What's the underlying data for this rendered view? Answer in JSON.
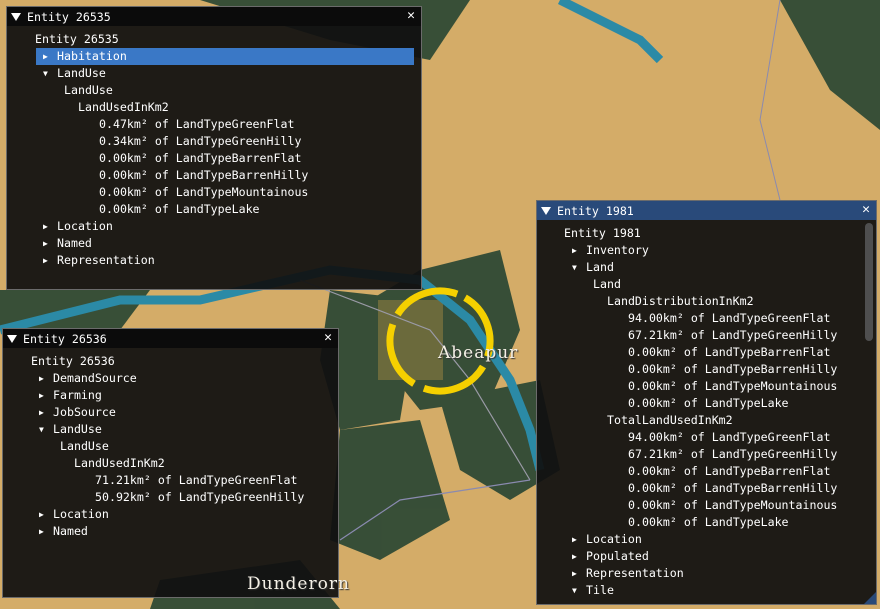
{
  "map": {
    "labels": [
      "Abeapur",
      "Dunderorn"
    ],
    "colors": {
      "sand": "#d4ac68",
      "forest": "#2f4a35",
      "river": "#2b8aa6",
      "marker": "#f5d000"
    }
  },
  "windows": [
    {
      "title": "Entity 26535",
      "root": "Entity 26535",
      "rows": [
        {
          "d": 1,
          "a": "closed",
          "t": "Habitation",
          "sel": true
        },
        {
          "d": 1,
          "a": "open",
          "t": "LandUse"
        },
        {
          "d": 2,
          "t": "LandUse"
        },
        {
          "d": 3,
          "t": "LandUsedInKm2"
        },
        {
          "d": 4,
          "t": "0.47km² of LandTypeGreenFlat"
        },
        {
          "d": 4,
          "t": "0.34km² of LandTypeGreenHilly"
        },
        {
          "d": 4,
          "t": "0.00km² of LandTypeBarrenFlat"
        },
        {
          "d": 4,
          "t": "0.00km² of LandTypeBarrenHilly"
        },
        {
          "d": 4,
          "t": "0.00km² of LandTypeMountainous"
        },
        {
          "d": 4,
          "t": "0.00km² of LandTypeLake"
        },
        {
          "d": 1,
          "a": "closed",
          "t": "Location"
        },
        {
          "d": 1,
          "a": "closed",
          "t": "Named"
        },
        {
          "d": 1,
          "a": "closed",
          "t": "Representation"
        }
      ]
    },
    {
      "title": "Entity 26536",
      "root": "Entity 26536",
      "rows": [
        {
          "d": 1,
          "a": "closed",
          "t": "DemandSource"
        },
        {
          "d": 1,
          "a": "closed",
          "t": "Farming"
        },
        {
          "d": 1,
          "a": "closed",
          "t": "JobSource"
        },
        {
          "d": 1,
          "a": "open",
          "t": "LandUse"
        },
        {
          "d": 2,
          "t": "LandUse"
        },
        {
          "d": 3,
          "t": "LandUsedInKm2"
        },
        {
          "d": 4,
          "t": "71.21km² of LandTypeGreenFlat"
        },
        {
          "d": 4,
          "t": "50.92km² of LandTypeGreenHilly"
        },
        {
          "d": 1,
          "a": "closed",
          "t": "Location"
        },
        {
          "d": 1,
          "a": "closed",
          "t": "Named"
        }
      ]
    },
    {
      "title": "Entity 1981",
      "root": "Entity 1981",
      "rows": [
        {
          "d": 1,
          "a": "closed",
          "t": "Inventory"
        },
        {
          "d": 1,
          "a": "open",
          "t": "Land"
        },
        {
          "d": 2,
          "t": "Land"
        },
        {
          "d": 3,
          "t": "LandDistributionInKm2"
        },
        {
          "d": 4,
          "t": "94.00km² of LandTypeGreenFlat"
        },
        {
          "d": 4,
          "t": "67.21km² of LandTypeGreenHilly"
        },
        {
          "d": 4,
          "t": "0.00km² of LandTypeBarrenFlat"
        },
        {
          "d": 4,
          "t": "0.00km² of LandTypeBarrenHilly"
        },
        {
          "d": 4,
          "t": "0.00km² of LandTypeMountainous"
        },
        {
          "d": 4,
          "t": "0.00km² of LandTypeLake"
        },
        {
          "d": 3,
          "t": "TotalLandUsedInKm2"
        },
        {
          "d": 4,
          "t": "94.00km² of LandTypeGreenFlat"
        },
        {
          "d": 4,
          "t": "67.21km² of LandTypeGreenHilly"
        },
        {
          "d": 4,
          "t": "0.00km² of LandTypeBarrenFlat"
        },
        {
          "d": 4,
          "t": "0.00km² of LandTypeBarrenHilly"
        },
        {
          "d": 4,
          "t": "0.00km² of LandTypeMountainous"
        },
        {
          "d": 4,
          "t": "0.00km² of LandTypeLake"
        },
        {
          "d": 1,
          "a": "closed",
          "t": "Location"
        },
        {
          "d": 1,
          "a": "closed",
          "t": "Populated"
        },
        {
          "d": 1,
          "a": "closed",
          "t": "Representation"
        },
        {
          "d": 1,
          "a": "open",
          "t": "Tile"
        }
      ]
    }
  ]
}
